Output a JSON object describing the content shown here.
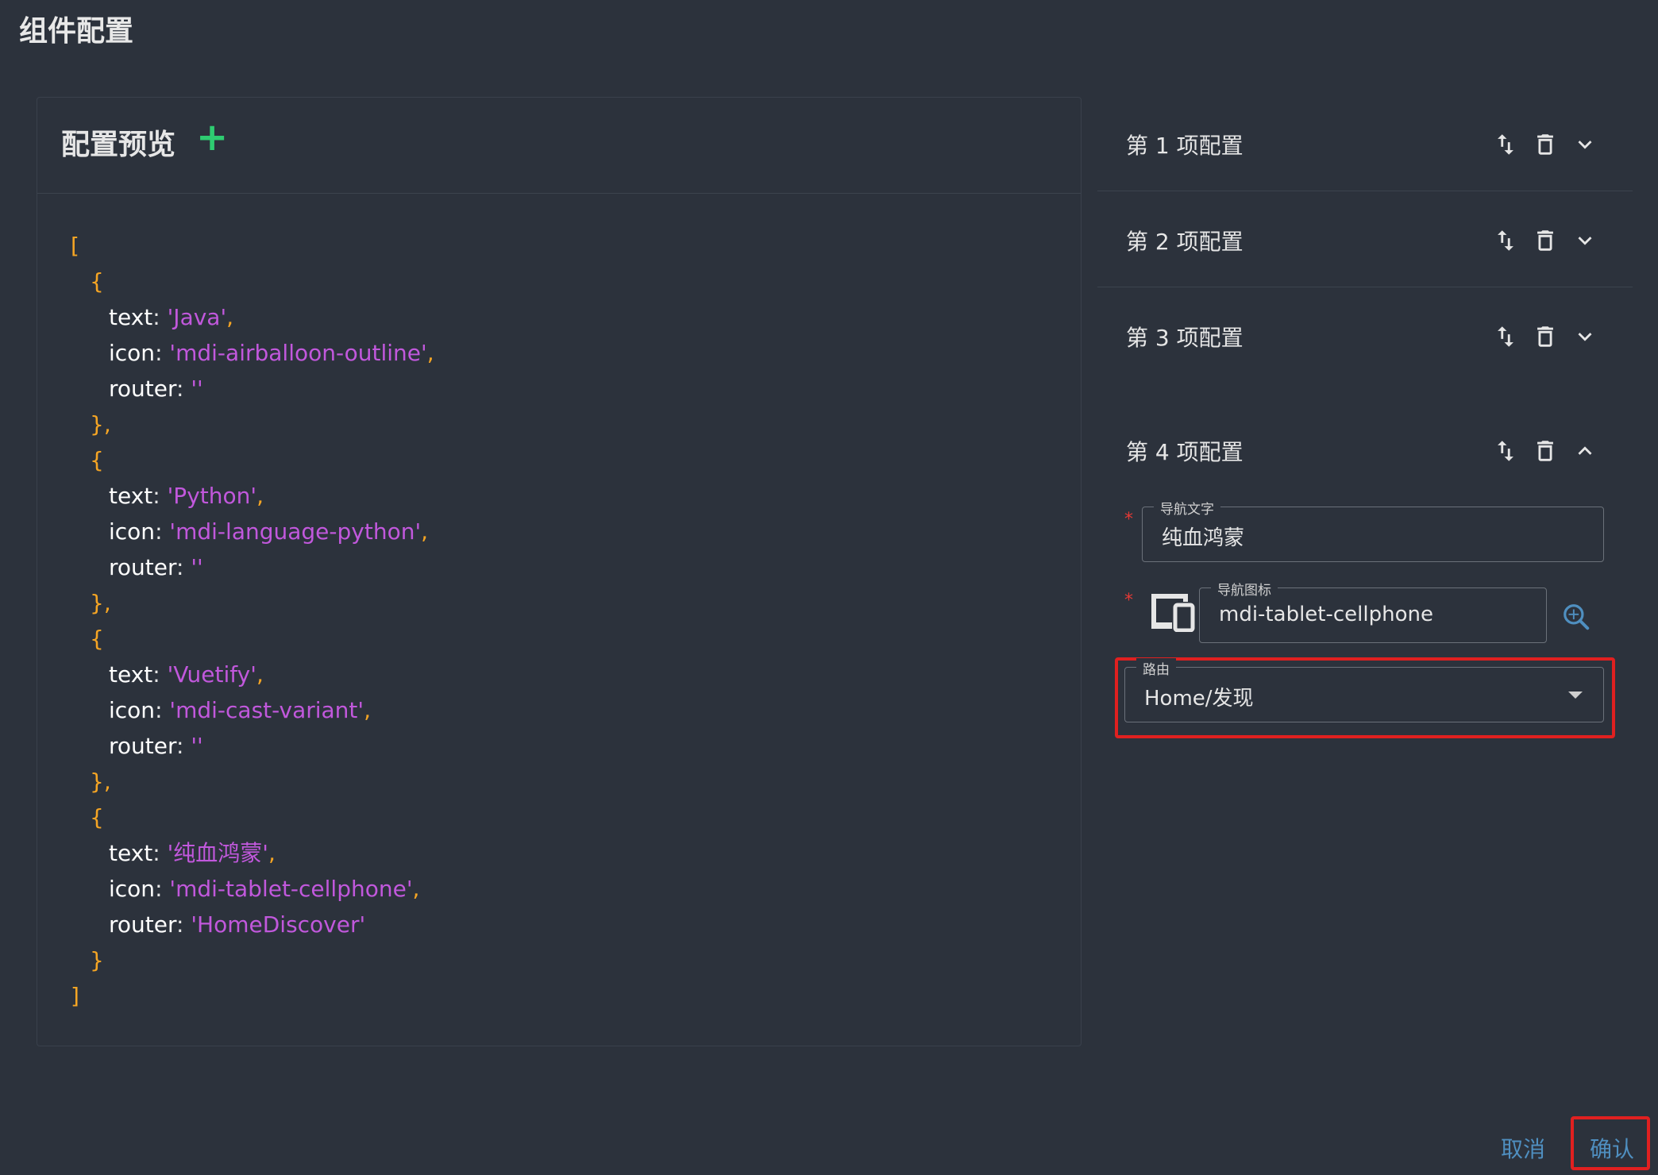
{
  "page": {
    "title": "组件配置"
  },
  "preview": {
    "title": "配置预览",
    "add_icon": "plus-icon",
    "code_lines": [
      [
        "p",
        "["
      ],
      [
        "i1",
        "p",
        "{"
      ],
      [
        "i2",
        "k",
        "text",
        ": ",
        "s",
        "'Java'",
        "p",
        ","
      ],
      [
        "i2",
        "k",
        "icon",
        ": ",
        "s",
        "'mdi-airballoon-outline'",
        "p",
        ","
      ],
      [
        "i2",
        "k",
        "router",
        ": ",
        "s",
        "''"
      ],
      [
        "i1",
        "p",
        "},"
      ],
      [
        "i1",
        "p",
        "{"
      ],
      [
        "i2",
        "k",
        "text",
        ": ",
        "s",
        "'Python'",
        "p",
        ","
      ],
      [
        "i2",
        "k",
        "icon",
        ": ",
        "s",
        "'mdi-language-python'",
        "p",
        ","
      ],
      [
        "i2",
        "k",
        "router",
        ": ",
        "s",
        "''"
      ],
      [
        "i1",
        "p",
        "},"
      ],
      [
        "i1",
        "p",
        "{"
      ],
      [
        "i2",
        "k",
        "text",
        ": ",
        "s",
        "'Vuetify'",
        "p",
        ","
      ],
      [
        "i2",
        "k",
        "icon",
        ": ",
        "s",
        "'mdi-cast-variant'",
        "p",
        ","
      ],
      [
        "i2",
        "k",
        "router",
        ": ",
        "s",
        "''"
      ],
      [
        "i1",
        "p",
        "},"
      ],
      [
        "i1",
        "p",
        "{"
      ],
      [
        "i2",
        "k",
        "text",
        ": ",
        "s",
        "'纯血鸿蒙'",
        "p",
        ","
      ],
      [
        "i2",
        "k",
        "icon",
        ": ",
        "s",
        "'mdi-tablet-cellphone'",
        "p",
        ","
      ],
      [
        "i2",
        "k",
        "router",
        ": ",
        "s",
        "'HomeDiscover'"
      ],
      [
        "i1",
        "p",
        "}"
      ],
      [
        "p",
        "]"
      ]
    ]
  },
  "config_items": [
    {
      "label": "第 1 项配置",
      "expanded": false
    },
    {
      "label": "第 2 项配置",
      "expanded": false
    },
    {
      "label": "第 3 项配置",
      "expanded": false
    },
    {
      "label": "第 4 项配置",
      "expanded": true
    }
  ],
  "form": {
    "nav_text": {
      "legend": "导航文字",
      "value": "纯血鸿蒙"
    },
    "nav_icon": {
      "legend": "导航图标",
      "value": "mdi-tablet-cellphone",
      "preview_icon": "tablet-cellphone-icon"
    },
    "route": {
      "legend": "路由",
      "value": "Home/发现"
    },
    "required_mark": "*"
  },
  "footer": {
    "cancel": "取消",
    "confirm": "确认"
  },
  "colors": {
    "accent": "#4f8fc0",
    "add": "#2ecc71",
    "punct": "#f5a524",
    "string": "#c158dc",
    "highlight": "#e02020"
  }
}
